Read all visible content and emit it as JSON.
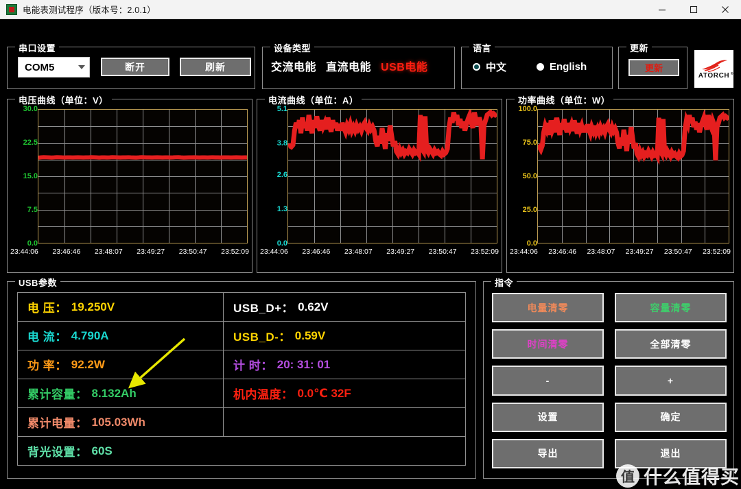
{
  "window": {
    "title": "电能表测试程序（版本号：2.0.1）",
    "app_icon": "meter-app-icon",
    "minimize_label": "minimize-icon",
    "maximize_label": "maximize-icon",
    "close_label": "close-icon"
  },
  "serial": {
    "legend": "串口设置",
    "port_value": "COM5",
    "disconnect_label": "断开",
    "refresh_label": "刷新"
  },
  "device": {
    "legend": "设备类型",
    "types": [
      {
        "label": "交流电能",
        "active": false
      },
      {
        "label": "直流电能",
        "active": false
      },
      {
        "label": "USB电能",
        "active": true
      }
    ],
    "active_color": "#ff1d10"
  },
  "language": {
    "legend": "语言",
    "options": [
      {
        "label": "中文",
        "selected": true
      },
      {
        "label": "English",
        "selected": false
      }
    ]
  },
  "update": {
    "legend": "更新",
    "button_label": "更新",
    "button_color": "#e01b10"
  },
  "brand": {
    "name": "ATORCH",
    "trademark": "®",
    "mark_color": "#e2231a"
  },
  "chart_data": [
    {
      "type": "line",
      "title": "电压曲线（单位：V）",
      "axis_color": "#1fc531",
      "line_color": "#e51f1f",
      "ylabel": "V",
      "xlabel": "",
      "ylim": [
        0,
        30
      ],
      "yticks": [
        "0.0",
        "7.5",
        "15.0",
        "22.5",
        "30.0"
      ],
      "ytick_values": [
        0,
        7.5,
        15,
        22.5,
        30
      ],
      "xticks": [
        "23:44:06",
        "23:46:46",
        "23:48:07",
        "23:49:27",
        "23:50:47",
        "23:52:09"
      ],
      "grid": true,
      "grid_cols": 7,
      "grid_rows": 8,
      "values": [
        19.2,
        19.25,
        19.3,
        19.28,
        19.25,
        19.22,
        19.25,
        19.3,
        19.28,
        19.25,
        19.24,
        19.26,
        19.25,
        19.23,
        19.25,
        19.27,
        19.25,
        19.24,
        19.26,
        19.25,
        19.3,
        19.28,
        19.25,
        19.22,
        19.25,
        19.26,
        19.24,
        19.25,
        19.3,
        19.27,
        19.25,
        19.23,
        19.25,
        19.26,
        19.28,
        19.25,
        19.24,
        19.22,
        19.25,
        19.3,
        19.28,
        19.25,
        19.26,
        19.24,
        19.25,
        19.27,
        19.25,
        19.23,
        19.25,
        19.26,
        19.24,
        19.25,
        19.28,
        19.3,
        19.25,
        19.22,
        19.24,
        19.26,
        19.25,
        19.27,
        19.25,
        19.24,
        19.26,
        19.25,
        19.23,
        19.25,
        19.28,
        19.26,
        19.25,
        19.24,
        19.25,
        19.26,
        19.25,
        19.24,
        19.25,
        19.27,
        19.25,
        19.23,
        19.25,
        19.25
      ]
    },
    {
      "type": "line",
      "title": "电流曲线（单位：A）",
      "axis_color": "#19d8d0",
      "line_color": "#e51f1f",
      "ylabel": "A",
      "xlabel": "",
      "ylim": [
        0,
        5.1
      ],
      "yticks": [
        "0.0",
        "1.3",
        "2.6",
        "3.8",
        "5.1"
      ],
      "ytick_values": [
        0,
        1.3,
        2.6,
        3.8,
        5.1
      ],
      "xticks": [
        "23:44:06",
        "23:46:46",
        "23:48:07",
        "23:49:27",
        "23:50:47",
        "23:52:09"
      ],
      "grid": true,
      "grid_cols": 7,
      "grid_rows": 8,
      "values": [
        3.7,
        3.72,
        3.68,
        3.75,
        4.3,
        4.6,
        4.4,
        4.7,
        4.2,
        4.8,
        4.4,
        4.6,
        4.3,
        4.9,
        4.5,
        4.2,
        4.7,
        4.4,
        4.85,
        4.5,
        4.3,
        4.7,
        4.45,
        4.6,
        4.35,
        4.8,
        4.5,
        4.25,
        4.7,
        4.4,
        4.6,
        4.3,
        4.55,
        4.3,
        4.6,
        4.4,
        4.25,
        4.5,
        4.35,
        4.55,
        4.3,
        4.45,
        4.3,
        4.5,
        4.35,
        4.45,
        4.3,
        4.5,
        4.6,
        4.4,
        4.3,
        4.5,
        4.35,
        4.45,
        4.3,
        3.9,
        3.7,
        4.1,
        3.8,
        4.4,
        4.0,
        3.6,
        4.2,
        3.9,
        4.5,
        4.1,
        3.7,
        3.9,
        3.5,
        3.4,
        3.6,
        3.45,
        3.55,
        3.4,
        3.5,
        3.45,
        3.6,
        3.5,
        3.4,
        3.55,
        3.45,
        3.5,
        3.4,
        4.9,
        3.6,
        3.5,
        4.85,
        3.55,
        3.45,
        3.6,
        3.5,
        3.4,
        3.55,
        3.45,
        3.5,
        3.4,
        3.35,
        3.5,
        3.4,
        3.45,
        3.6,
        4.4,
        4.8,
        4.6,
        5.0,
        4.7,
        4.9,
        4.5,
        4.75,
        4.4,
        4.65,
        4.3,
        4.55,
        4.75,
        4.9,
        4.6,
        4.4,
        5.0,
        4.7,
        4.5,
        4.8,
        4.6,
        3.2,
        4.5,
        4.7,
        4.9,
        4.95,
        5.0,
        4.9,
        4.95,
        4.9,
        4.95
      ]
    },
    {
      "type": "line",
      "title": "功率曲线（单位：W）",
      "axis_color": "#e8c21a",
      "line_color": "#e51f1f",
      "ylabel": "W",
      "xlabel": "",
      "ylim": [
        0,
        100
      ],
      "yticks": [
        "0.0",
        "25.0",
        "50.0",
        "75.0",
        "100.0"
      ],
      "ytick_values": [
        0,
        25,
        50,
        75,
        100
      ],
      "xticks": [
        "23:44:06",
        "23:46:46",
        "23:48:07",
        "23:49:27",
        "23:50:47",
        "23:52:09"
      ],
      "grid": true,
      "grid_cols": 7,
      "grid_rows": 8,
      "values": [
        71,
        72,
        70,
        73,
        83,
        88,
        85,
        90,
        81,
        92,
        85,
        88,
        83,
        94,
        87,
        81,
        90,
        85,
        93,
        87,
        83,
        90,
        86,
        89,
        84,
        92,
        87,
        82,
        90,
        85,
        88,
        83,
        88,
        83,
        89,
        85,
        82,
        87,
        84,
        88,
        83,
        86,
        83,
        87,
        84,
        86,
        83,
        87,
        89,
        85,
        83,
        87,
        84,
        86,
        83,
        75,
        71,
        79,
        73,
        85,
        77,
        69,
        81,
        75,
        87,
        79,
        71,
        75,
        67,
        65,
        69,
        66,
        68,
        65,
        67,
        66,
        69,
        67,
        65,
        68,
        66,
        67,
        65,
        94,
        69,
        67,
        93,
        68,
        66,
        69,
        67,
        65,
        68,
        66,
        67,
        65,
        64,
        67,
        65,
        66,
        69,
        85,
        92,
        89,
        96,
        90,
        94,
        87,
        91,
        85,
        90,
        83,
        88,
        91,
        94,
        89,
        85,
        96,
        90,
        87,
        92,
        89,
        62,
        87,
        90,
        94,
        95,
        96,
        94,
        95,
        94,
        95
      ]
    }
  ],
  "usb_params": {
    "legend": "USB参数",
    "rows": [
      {
        "left": {
          "label": "电    压：",
          "value": "19.250V",
          "color": "#ffd400"
        },
        "right": {
          "label": "USB_D+：",
          "value": "0.62V",
          "color": "#ffffff"
        }
      },
      {
        "left": {
          "label": "电    流：",
          "value": "4.790A",
          "color": "#19d8d0"
        },
        "right": {
          "label": "USB_D-：",
          "value": "0.59V",
          "color": "#ffd400"
        }
      },
      {
        "left": {
          "label": "功    率：",
          "value": "92.2W",
          "color": "#ff9a17"
        },
        "right": {
          "label": "计    时：",
          "value": "20: 31: 01",
          "color": "#b44de0"
        }
      },
      {
        "left": {
          "label": "累计容量：",
          "value": "8.132Ah",
          "color": "#33cc66"
        },
        "right": {
          "label": "机内温度：",
          "value": "0.0℃ 32F",
          "color": "#ff2010"
        }
      },
      {
        "left": {
          "label": "累计电量：",
          "value": "105.03Wh",
          "color": "#f08a6a"
        },
        "right": {
          "label": "",
          "value": "",
          "color": "#ffffff"
        }
      },
      {
        "left": {
          "label": "背光设置：",
          "value": "60S",
          "color": "#5fe0a8"
        },
        "right": {
          "label": "",
          "value": "",
          "color": "#ffffff"
        }
      }
    ]
  },
  "commands": {
    "legend": "指令",
    "buttons": [
      {
        "label": "电量清零",
        "color": "#f08a5a"
      },
      {
        "label": "容量清零",
        "color": "#3ecf6b"
      },
      {
        "label": "时间清零",
        "color": "#e040c8"
      },
      {
        "label": "全部清零",
        "color": "#ffffff"
      },
      {
        "label": "-",
        "color": "#ffffff"
      },
      {
        "label": "+",
        "color": "#ffffff"
      },
      {
        "label": "设置",
        "color": "#ffffff"
      },
      {
        "label": "确定",
        "color": "#ffffff"
      },
      {
        "label": "导出",
        "color": "#ffffff"
      },
      {
        "label": "退出",
        "color": "#ffffff"
      }
    ]
  },
  "annotation": {
    "arrow_color": "#e8e800",
    "points_to": "92.2W"
  },
  "watermark": {
    "logo_char": "值",
    "text": "什么值得买"
  }
}
